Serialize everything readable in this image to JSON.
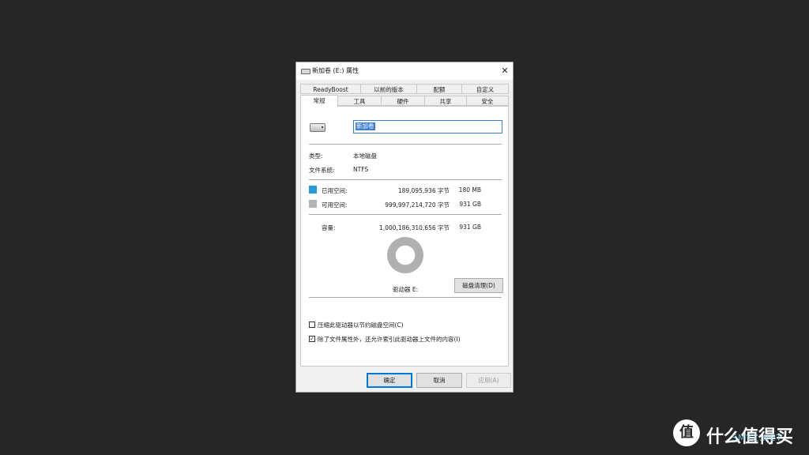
{
  "window": {
    "title": "新加卷 (E:) 属性",
    "close_glyph": "✕",
    "icon": "drive-icon"
  },
  "tabs": {
    "row1": [
      "ReadyBoost",
      "以前的版本",
      "配额",
      "自定义"
    ],
    "row2": [
      "常规",
      "工具",
      "硬件",
      "共享",
      "安全"
    ],
    "active": "常规"
  },
  "general": {
    "volume_name": "新加卷",
    "type_label": "类型:",
    "type_value": "本地磁盘",
    "fs_label": "文件系统:",
    "fs_value": "NTFS",
    "used_label": "已用空间:",
    "used_bytes": "189,095,936 字节",
    "used_size": "180 MB",
    "free_label": "可用空间:",
    "free_bytes": "999,997,214,720 字节",
    "free_size": "931 GB",
    "capacity_label": "容量:",
    "capacity_bytes": "1,000,186,310,656 字节",
    "capacity_size": "931 GB",
    "drive_label": "驱动器 E:",
    "cleanup_button": "磁盘清理(D)",
    "compress_label": "压缩此驱动器以节约磁盘空间(C)",
    "compress_checked": false,
    "index_label": "除了文件属性外，还允许索引此驱动器上文件的内容(I)",
    "index_checked": true,
    "used_color": "#2b9bd8",
    "free_color": "#b4b4b4"
  },
  "buttons": {
    "ok": "确定",
    "cancel": "取消",
    "apply": "应用(A)"
  },
  "watermark": {
    "badge": "值",
    "text": "什么值得买",
    "sub": "SMYZ.NET"
  }
}
